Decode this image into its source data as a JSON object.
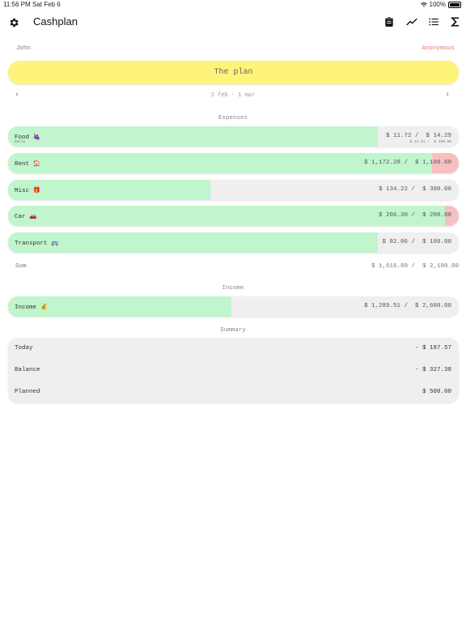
{
  "status_bar": {
    "time": "11:56 PM",
    "date": "Sat Feb 6",
    "battery": "100%"
  },
  "nav": {
    "title": "Cashplan",
    "icons": [
      "gear-icon",
      "clipboard-icon",
      "trend-icon",
      "list-icon",
      "sigma-icon"
    ]
  },
  "people": {
    "me": "John",
    "other": "Anonymous"
  },
  "plan": {
    "label": "The plan",
    "accent": "#fff47a"
  },
  "period": {
    "label": "1 feb - 1 mar",
    "prev": "‹",
    "next": "›"
  },
  "colors": {
    "progress": "#c0f5cd",
    "over_budget": "#f7c0c0",
    "track": "#efefef",
    "partner": "#e57373"
  },
  "expenses": {
    "heading": "Expenses",
    "items": [
      {
        "name": "Food 🍇",
        "sub": "Daily",
        "spent": "$ 11.72 /",
        "budget": "$ 14.29",
        "sub_spent": "$ 12.41 /",
        "sub_budget": "$ 400.00",
        "progress": 0.82,
        "over": 0
      },
      {
        "name": "Rent 🏠",
        "spent": "$ 1,172.28 /",
        "budget": "$ 1,100.00",
        "progress": 0.94,
        "over": 0.06
      },
      {
        "name": "Misc 🎁",
        "spent": "$ 134.22 /",
        "budget": "$ 300.00",
        "progress": 0.448,
        "over": 0
      },
      {
        "name": "Car 🚗",
        "spent": "$ 206.30 /",
        "budget": "$ 200.00",
        "progress": 0.97,
        "over": 0.03
      },
      {
        "name": "Transport 🚌",
        "spent": "$ 82.06 /",
        "budget": "$ 100.00",
        "progress": 0.82,
        "over": 0
      }
    ],
    "sum_label": "Sum",
    "sum_spent": "$ 1,616.89 /",
    "sum_budget": "$ 2,100.00"
  },
  "income": {
    "heading": "Income",
    "items": [
      {
        "name": "Income 💰",
        "spent": "$ 1,289.51 /",
        "budget": "$ 2,600.00",
        "progress": 0.496,
        "over": 0
      }
    ]
  },
  "summary": {
    "heading": "Summary",
    "rows": [
      {
        "label": "Today",
        "value": "- $ 187.57"
      },
      {
        "label": "Balance",
        "value": "- $ 327.38"
      },
      {
        "label": "Planned",
        "value": "$ 500.00"
      }
    ]
  }
}
